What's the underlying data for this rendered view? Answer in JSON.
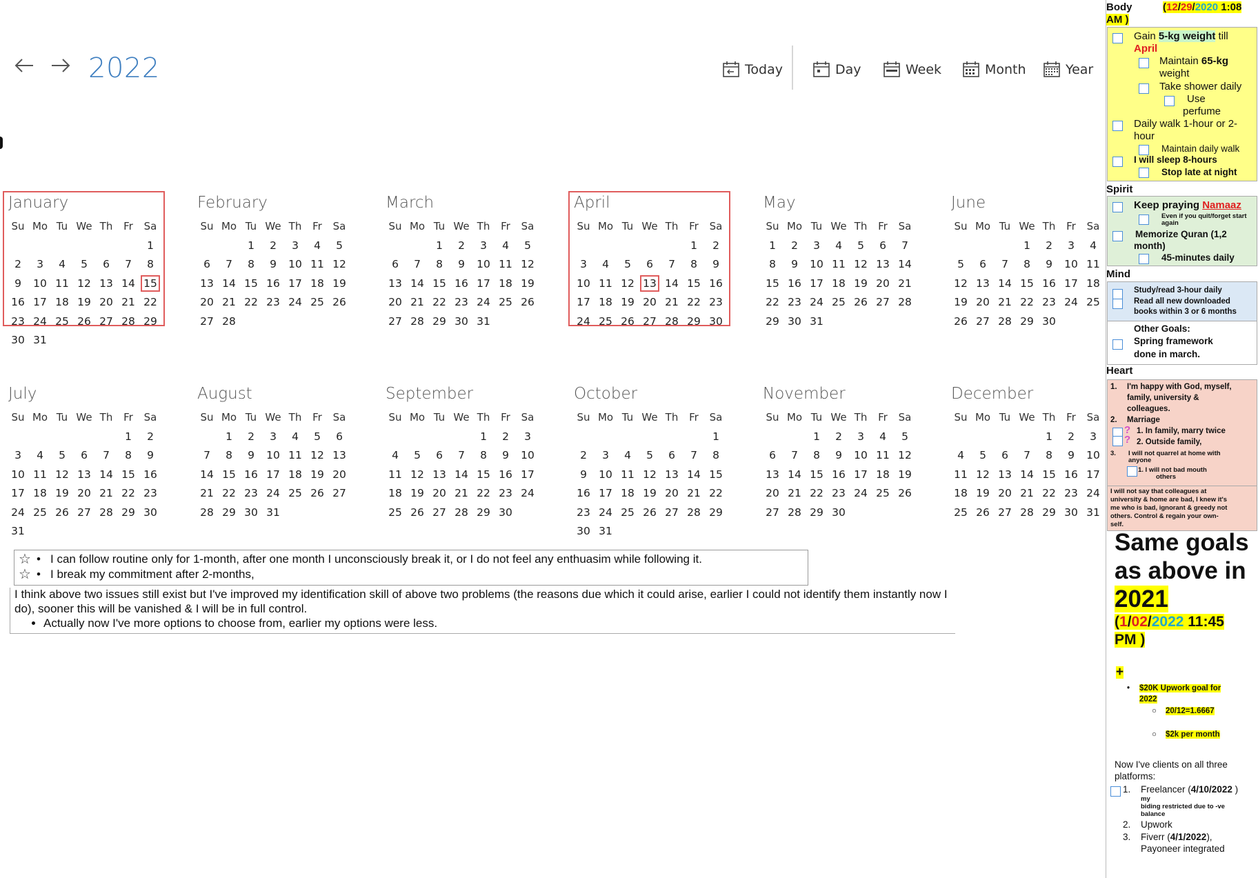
{
  "nav": {
    "year": "2022"
  },
  "toolbar": {
    "today": "Today",
    "day": "Day",
    "week": "Week",
    "month": "Month",
    "year": "Year"
  },
  "dow": [
    "Su",
    "Mo",
    "Tu",
    "We",
    "Th",
    "Fr",
    "Sa"
  ],
  "months": [
    {
      "name": "January",
      "start": 6,
      "days": 31,
      "mark": 15,
      "hl": true
    },
    {
      "name": "February",
      "start": 2,
      "days": 28
    },
    {
      "name": "March",
      "start": 2,
      "days": 31
    },
    {
      "name": "April",
      "start": 5,
      "days": 30,
      "mark": 13,
      "hl": true
    },
    {
      "name": "May",
      "start": 0,
      "days": 31
    },
    {
      "name": "June",
      "start": 3,
      "days": 30
    },
    {
      "name": "July",
      "start": 5,
      "days": 31
    },
    {
      "name": "August",
      "start": 1,
      "days": 31
    },
    {
      "name": "September",
      "start": 4,
      "days": 30
    },
    {
      "name": "October",
      "start": 6,
      "days": 31
    },
    {
      "name": "November",
      "start": 2,
      "days": 30
    },
    {
      "name": "December",
      "start": 4,
      "days": 31
    }
  ],
  "notes": {
    "item1": "I can follow routine only for 1-month, after one month I unconsciously break it, or I do not feel any enthuasim while following it.",
    "item2": "I break my commitment after 2-months,",
    "para": "I think above two issues still exist but I've improved my identification skill of above two problems (the reasons due which it could arise, earlier I could not identify them instantly now I do), sooner this will be vanished & I will be in full control.",
    "bullet": "Actually now I've more options to choose from, earlier my options were less."
  },
  "panel": {
    "body_title": "Body",
    "body_date": {
      "open": "(",
      "m": "12",
      "s1": "/",
      "d": "29",
      "s2": "/",
      "y": "2020",
      "time": " 1:08",
      "ampm": "AM )"
    },
    "body": {
      "g1a": "Gain ",
      "g1b": "5-kg weight",
      "g1c": " till",
      "g1d": "April",
      "g2a": "Maintain ",
      "g2b": "65-kg",
      "g2c": "weight",
      "g3": "Take shower daily",
      "g4a": "Use",
      "g4b": "perfume",
      "g5a": "Daily walk 1-hour or 2-",
      "g5b": "hour",
      "g6": "Maintain daily walk",
      "g7": "I will sleep 8-hours",
      "g8": "Stop late at night"
    },
    "spirit_title": "Spirit",
    "spirit": {
      "s1a": "Keep praying ",
      "s1b": "Namaaz",
      "s2a": "Even if you quit/forget start",
      "s2b": "again",
      "s3a": "Memorize Quran (1,2",
      "s3b": "month)",
      "s4": "45-minutes daily"
    },
    "mind_title": "Mind",
    "mind": {
      "m1": "Study/read 3-hour daily",
      "m2a": "Read all new downloaded",
      "m2b": "books within 3 or 6 months",
      "o1": "Other Goals:",
      "o2": "Spring framework",
      "o3": "done in march."
    },
    "heart_title": "Heart",
    "heart": {
      "h1n": "1.",
      "h1a": "I'm happy with God, myself,",
      "h1b": "family, university &",
      "h1c": "colleagues.",
      "h2n": "2.",
      "h2": "Marriage",
      "h3": "1.   In family, marry twice",
      "h4": "2.   Outside family,",
      "h5n": "3.",
      "h5a": "I will not quarrel at home with",
      "h5b": "anyone",
      "h6a": "1.   I will not bad mouth",
      "h6b": "others",
      "h7a": "I will not say that colleagues at",
      "h7b": "university & home are bad, I knew it's",
      "h7c": "me who is bad, ignorant & greedy not",
      "h7d": "others. Control & regain your own-",
      "h7e": "self."
    },
    "same": {
      "l1": "Same goals",
      "l2": "as above in",
      "l3": "2021"
    },
    "date2": {
      "open": "(",
      "m": "1",
      "s1": "/",
      "d": "02",
      "s2": "/",
      "y": "2022",
      "time": " 11:45",
      "ampm": "PM  )"
    },
    "plus": "+",
    "upwork": {
      "b1a": "$20K Upwork goal for",
      "b1b": "2022",
      "b2": "20/12=1.6667",
      "b3": "$2k per month"
    },
    "clients": {
      "intro1": "Now I've clients on all three",
      "intro2": "platforms:",
      "c1n": "1.",
      "c1a": "Freelancer (",
      "c1b": "4/10/2022",
      "c1c": " )",
      "c1d": "my",
      "c1e": "biding restricted due to -ve",
      "c1f": "balance",
      "c2n": "2.",
      "c2": "Upwork",
      "c3n": "3.",
      "c3a": "Fiverr (",
      "c3b": "4/1/2022",
      "c3c": "),",
      "c3d": "Payoneer integrated"
    }
  }
}
